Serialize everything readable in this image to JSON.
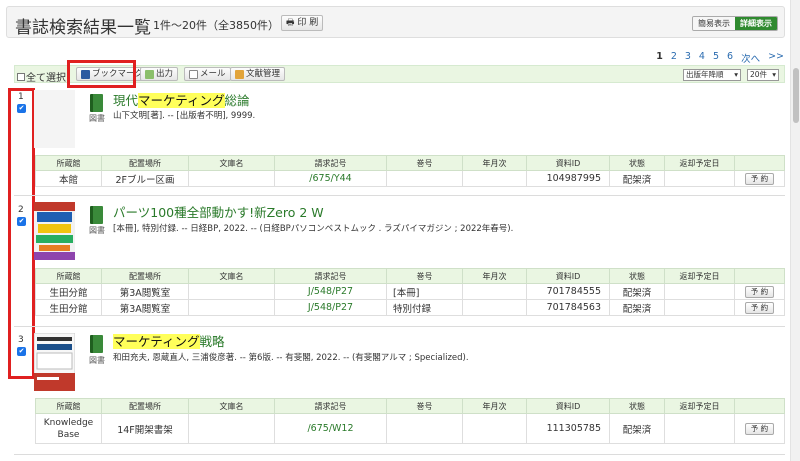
{
  "header": {
    "title": "書誌検索結果一覧",
    "count": "1件〜20件（全3850件）",
    "print_label": "印 刷",
    "simple_view": "簡易表示",
    "detail_view": "詳細表示"
  },
  "pager": {
    "pages": [
      "1",
      "2",
      "3",
      "4",
      "5",
      "6"
    ],
    "next": "次へ",
    "last": ">>"
  },
  "toolbar": {
    "select_all": "全て選択",
    "bookmark": "ブックマーク",
    "output": "出力",
    "mail": "メール",
    "ref_manage": "文献管理",
    "sort_value": "出版年降順",
    "per_page_value": "20件"
  },
  "holdings_headers": [
    "所蔵館",
    "配置場所",
    "文庫名",
    "請求記号",
    "巻号",
    "年月次",
    "資料ID",
    "状態",
    "返却予定日",
    ""
  ],
  "records": [
    {
      "num": "1",
      "type": "図書",
      "title_pre": "現代",
      "title_hl": "マーケティング",
      "title_post": "総論",
      "meta": "山下文明[著]. -- [出版者不明], 9999.",
      "holdings": [
        {
          "lib": "本館",
          "loc": "2Fブルー区画",
          "bunko": "",
          "call": "/675/Y44",
          "vol": "",
          "year": "",
          "id": "104987995",
          "status": "配架済",
          "due": "",
          "reserve": "予 約"
        }
      ]
    },
    {
      "num": "2",
      "type": "図書",
      "title_pre": "パーツ100種全部動かす!新Zero 2 W",
      "title_hl": "",
      "title_post": "",
      "meta": "[本冊], 特別付録. -- 日経BP, 2022. -- (日経BPパソコンベストムック . ラズパイマガジン ; 2022年春号).",
      "holdings": [
        {
          "lib": "生田分館",
          "loc": "第3A閲覧室",
          "bunko": "",
          "call": "J/548/P27",
          "vol": "[本冊]",
          "year": "",
          "id": "701784555",
          "status": "配架済",
          "due": "",
          "reserve": "予 約"
        },
        {
          "lib": "生田分館",
          "loc": "第3A閲覧室",
          "bunko": "",
          "call": "J/548/P27",
          "vol": "特別付録",
          "year": "",
          "id": "701784563",
          "status": "配架済",
          "due": "",
          "reserve": "予 約"
        }
      ]
    },
    {
      "num": "3",
      "type": "図書",
      "title_pre": "",
      "title_hl": "マーケティング",
      "title_post": "戦略",
      "meta": "和田充夫, 恩蔵直人, 三浦俊彦著. -- 第6版. -- 有斐閣, 2022. -- (有斐閣アルマ ; Specialized).",
      "holdings": [
        {
          "lib": "Knowledge Base",
          "loc": "14F開架書架",
          "bunko": "",
          "call": "/675/W12",
          "vol": "",
          "year": "",
          "id": "111305785",
          "status": "配架済",
          "due": "",
          "reserve": "予 約"
        }
      ]
    }
  ],
  "colors": {
    "accent_green": "#2f8a2f",
    "highlight": "#ffff5a",
    "annotation_red": "#e02020",
    "link_blue": "#2b6cb0"
  }
}
